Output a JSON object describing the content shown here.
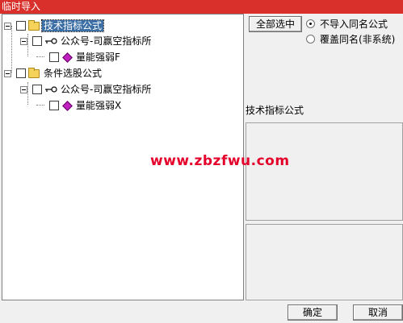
{
  "window": {
    "title": "临时导入"
  },
  "tree": {
    "nodes": [
      {
        "label": "技术指标公式"
      },
      {
        "label": "公众号-司赢空指标所"
      },
      {
        "label": "量能强弱F"
      },
      {
        "label": "条件选股公式"
      },
      {
        "label": "公众号-司赢空指标所"
      },
      {
        "label": "量能强弱X"
      }
    ]
  },
  "controls": {
    "select_all": "全部选中",
    "radio_skip": "不导入同名公式",
    "radio_overwrite": "覆盖同名(非系统)"
  },
  "info": {
    "section_label": "技术指标公式"
  },
  "watermark": "www.zbzfwu.com",
  "footer": {
    "ok": "确定",
    "cancel": "取消"
  },
  "colors": {
    "titlebar": "#d9302b",
    "selection": "#3a6ea5",
    "watermark": "#e4002b"
  }
}
